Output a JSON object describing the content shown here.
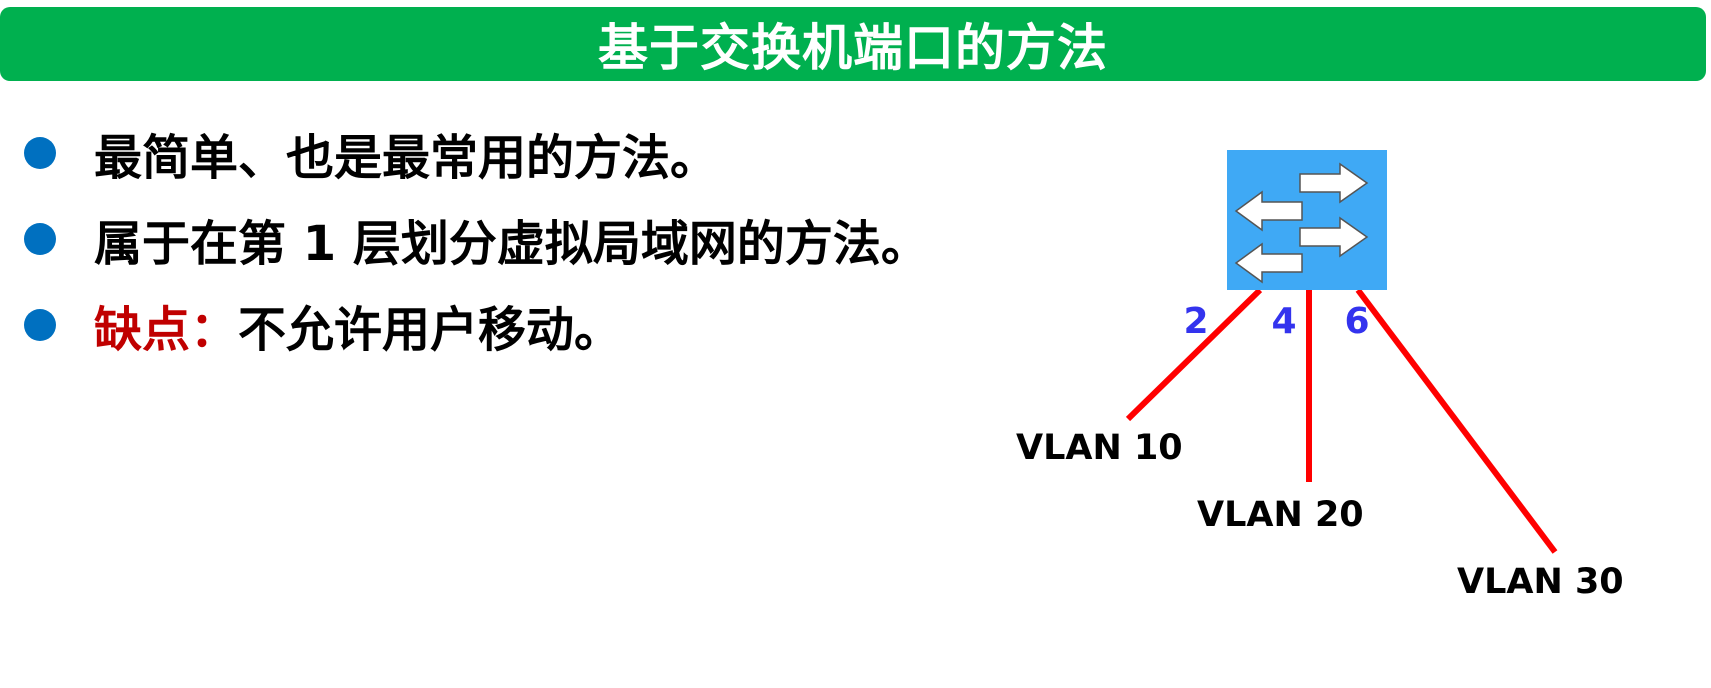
{
  "title": "基于交换机端口的方法",
  "bullets": [
    {
      "text": "最简单、也是最常用的方法。"
    },
    {
      "text": "属于在第 1 层划分虚拟局域网的方法。"
    },
    {
      "emphasis": "缺点：",
      "text": "不允许用户移动。"
    }
  ],
  "diagram": {
    "switch_icon": "switch-icon",
    "ports": [
      "2",
      "4",
      "6"
    ],
    "vlans": [
      "VLAN 10",
      "VLAN 20",
      "VLAN 30"
    ],
    "colors": {
      "title_bar": "#00b04f",
      "bullet": "#0070c0",
      "emphasis": "#c00000",
      "switch": "#3fa9f5",
      "link": "#ff0000",
      "port_label": "#3333ee"
    }
  }
}
